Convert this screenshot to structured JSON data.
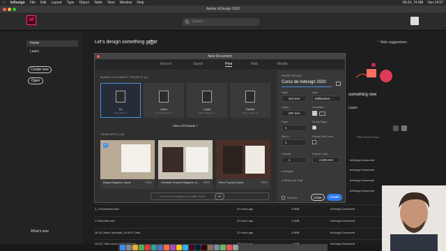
{
  "menubar": {
    "app": "InDesign",
    "items": [
      "File",
      "Edit",
      "Layout",
      "Type",
      "Object",
      "Table",
      "View",
      "Window",
      "Help"
    ],
    "status": [
      "09:24, 74 MB",
      "Ven 14:57"
    ]
  },
  "window": {
    "title": "Adobe InDesign 2020"
  },
  "appbar": {
    "logo": "Id",
    "search_placeholder": "Search"
  },
  "sidebar": {
    "home": "Home",
    "learn": "Learn",
    "create_new": "Create new",
    "open": "Open",
    "whats_new": "What's new"
  },
  "home": {
    "greeting": "Let's design something great",
    "hide_suggestions": "Hide suggestions",
    "bg_heading": "something new",
    "bg_learn": "Learn",
    "bg_filter": "Filter Recent Files"
  },
  "dialog": {
    "title": "New Document",
    "tabs": [
      "Recent",
      "Saved",
      "Print",
      "Web",
      "Mobile"
    ],
    "active_tab": "Print",
    "presets_heading": "BLANK DOCUMENT PRESETS",
    "presets_count": "(6)",
    "presets": [
      {
        "name": "A4",
        "dims": "210 x 297 mm"
      },
      {
        "name": "Letter",
        "dims": "215,9 x 279,4 mm"
      },
      {
        "name": "Legal",
        "dims": "215,9 x 355,6 mm"
      },
      {
        "name": "Tabloid",
        "dims": "279,4 x 431,8 mm"
      }
    ],
    "view_all": "View All Presets",
    "templates_heading": "TEMPLATES",
    "templates_count": "(15)",
    "templates": [
      {
        "name": "Elegant Magazine Layout",
        "price": "FREE"
      },
      {
        "name": "Geometric Tempore Magazine La...",
        "price": "FREE"
      },
      {
        "name": "Retro Proposal Layout",
        "price": "FREE"
      }
    ],
    "find_placeholder": "Find more templates on Adobe Stock",
    "go": "Go",
    "details": {
      "heading": "PRESET DETAILS",
      "doc_name": "Curso de Indesign 2020",
      "width_label": "Width",
      "width": "210 mm",
      "units_label": "Units",
      "units": "Millimeters",
      "height_label": "Height",
      "height": "297 mm",
      "orientation_label": "Orientation",
      "pages_label": "Pages",
      "pages": "1",
      "facing_label": "Facing Pages",
      "start_label": "Start #",
      "start": "1",
      "primary_label": "Primary Text Frame",
      "columns_label": "Columns",
      "columns": "1",
      "gutter_label": "Column Gutter",
      "gutter": "4,233 mm",
      "margins": "Margins",
      "bleed": "Bleed and Slug",
      "preview": "Preview",
      "close": "Close",
      "create": "Create"
    }
  },
  "files": [
    {
      "name": "2_3 Sommario.indd",
      "time": "22 hours ago",
      "size": "3.5MB",
      "type": "InDesign Document"
    },
    {
      "name": "1 Editoriale.indd",
      "time": "22 hours ago",
      "size": "1.4MB",
      "type": "InDesign Document"
    },
    {
      "name": "28-33_Menu Speciale_16.53.07.indd",
      "time": "22 hours ago",
      "size": "3.5MB",
      "type": "InDesign Document"
    },
    {
      "name": "26-23_Tutti Lavoro 16.53.07.indd",
      "time": "22 hours ago",
      "size": "1.4MB",
      "type": "InDesign Document"
    }
  ],
  "side_files": [
    "InDesign Document",
    "InDesign Document",
    "InDesign Document",
    "InDesign Document",
    "InDesign Document",
    "InDesign Document",
    "InDesign Document"
  ],
  "colors": {
    "accent": "#4a90e2",
    "brand": "#ff3366",
    "create": "#2f7bf0"
  }
}
